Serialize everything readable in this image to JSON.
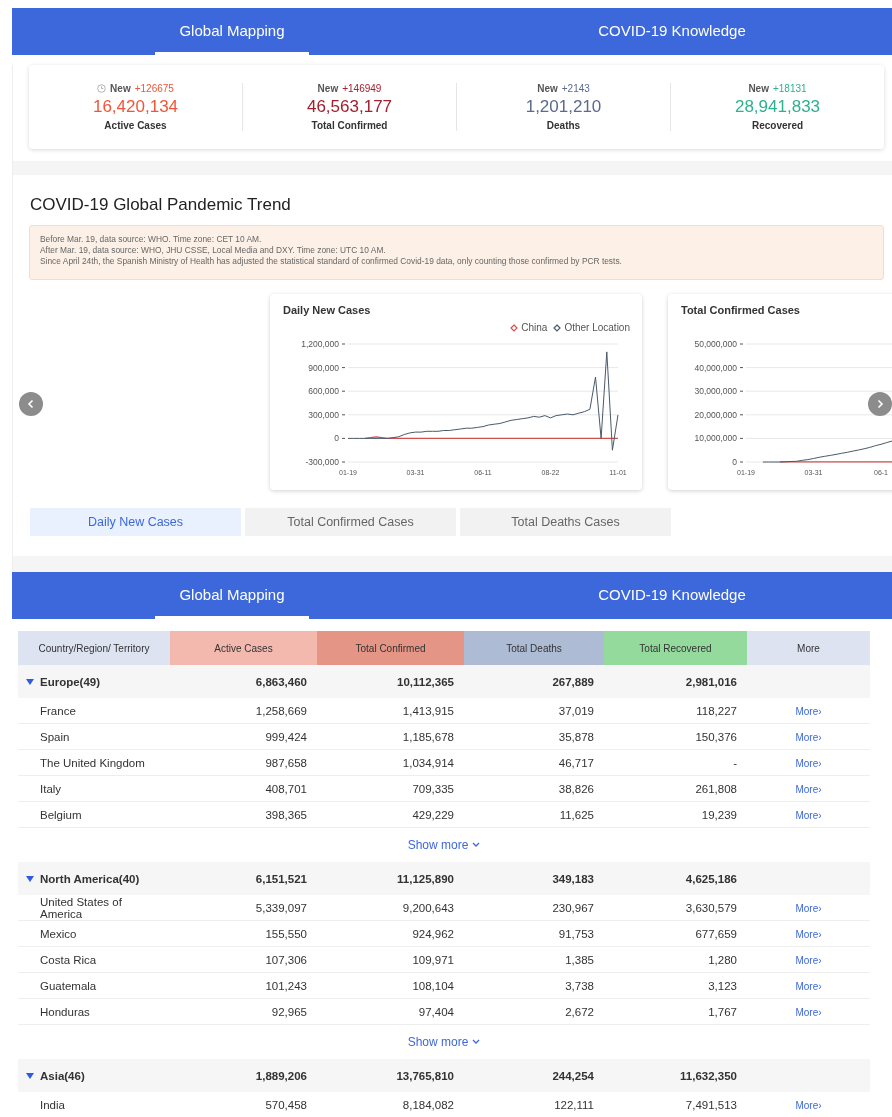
{
  "top_tabs": [
    {
      "label": "Global Mapping",
      "selected": true
    },
    {
      "label": "COVID-19 Knowledge",
      "selected": false
    }
  ],
  "stats": [
    {
      "new_label": "New",
      "new_value": "+126675",
      "value": "16,420,134",
      "label": "Active Cases",
      "color": "#f0553a",
      "clock": true
    },
    {
      "new_label": "New",
      "new_value": "+146949",
      "value": "46,563,177",
      "label": "Total Confirmed",
      "color": "#a3202f",
      "clock": false
    },
    {
      "new_label": "New",
      "new_value": "+2143",
      "value": "1,201,210",
      "label": "Deaths",
      "color": "#5b6a8e",
      "clock": false
    },
    {
      "new_label": "New",
      "new_value": "+18131",
      "value": "28,941,833",
      "label": "Recovered",
      "color": "#2fb08e",
      "clock": false
    }
  ],
  "trend": {
    "title": "COVID-19 Global Pandemic Trend",
    "notes": [
      "Before Mar. 19, data source: WHO. Time zone: CET 10 AM.",
      "After Mar. 19, data source: WHO, JHU CSSE, Local Media and DXY. Time zone: UTC 10 AM.",
      "Since April 24th, the Spanish Ministry of Health has adjusted the statistical standard of confirmed Covid-19 data, only counting those confirmed by PCR tests."
    ],
    "charts": [
      {
        "chart_data": {
          "type": "line",
          "title": "Daily New Cases",
          "categories": [
            "01-19",
            null,
            null,
            null,
            null,
            null,
            null,
            null,
            null,
            null,
            null,
            null,
            "03-31",
            null,
            null,
            null,
            null,
            null,
            null,
            null,
            null,
            null,
            null,
            null,
            "06-11",
            null,
            null,
            null,
            null,
            null,
            null,
            null,
            null,
            null,
            null,
            null,
            "08-22",
            null,
            null,
            null,
            null,
            null,
            null,
            null,
            null,
            null,
            null,
            null,
            "11-01"
          ],
          "series": [
            {
              "name": "China",
              "color": "#d05050",
              "values": [
                null,
                null,
                null,
                0,
                10000,
                20000,
                10000,
                0,
                0,
                0,
                0,
                0,
                0,
                0,
                0,
                0,
                0,
                0,
                0,
                0,
                0,
                0,
                0,
                0,
                0,
                0,
                0,
                0,
                0,
                0,
                0,
                0,
                0,
                0,
                0,
                0,
                0,
                0,
                0,
                0,
                0,
                0,
                0,
                0,
                0,
                0,
                0,
                0,
                0
              ]
            },
            {
              "name": "Other Location",
              "color": "#4a5a6a",
              "values": [
                0,
                0,
                0,
                0,
                0,
                0,
                0,
                0,
                10000,
                20000,
                50000,
                70000,
                80000,
                80000,
                90000,
                90000,
                90000,
                100000,
                100000,
                110000,
                120000,
                130000,
                130000,
                140000,
                150000,
                170000,
                180000,
                190000,
                210000,
                230000,
                240000,
                250000,
                260000,
                280000,
                270000,
                290000,
                260000,
                290000,
                300000,
                310000,
                300000,
                320000,
                340000,
                370000,
                780000,
                0,
                1100000,
                -150000,
                300000
              ]
            }
          ],
          "ylim": [
            -300000,
            1200000
          ],
          "grid": true,
          "legend": true,
          "yticks": [
            {
              "value": 1200000,
              "label": "1,200,000"
            },
            {
              "value": 900000,
              "label": "900,000"
            },
            {
              "value": 600000,
              "label": "600,000"
            },
            {
              "value": 300000,
              "label": "300,000"
            },
            {
              "value": 0,
              "label": "0"
            },
            {
              "value": -300000,
              "label": "-300,000"
            }
          ]
        }
      },
      {
        "chart_data": {
          "type": "line",
          "title": "Total Confirmed Cases",
          "categories": [
            "01-19",
            null,
            null,
            null,
            null,
            null,
            null,
            null,
            null,
            null,
            null,
            null,
            "03-31",
            null,
            null,
            null,
            null,
            null,
            null,
            null,
            null,
            null,
            null,
            null,
            "06-1",
            null,
            null,
            null,
            null,
            null,
            null,
            null,
            null,
            null,
            null,
            null,
            null,
            null,
            null,
            null,
            null,
            null,
            null,
            null,
            null,
            null,
            null,
            null,
            null
          ],
          "series": [
            {
              "color": "#d05050",
              "values": [
                null,
                null,
                null,
                null,
                null,
                null,
                100000,
                100000,
                100000,
                100000,
                100000,
                100000,
                100000,
                100000,
                100000,
                100000,
                100000,
                100000,
                100000,
                100000,
                100000,
                100000,
                100000,
                100000,
                100000,
                100000,
                100000,
                null,
                null,
                null,
                null,
                null,
                null,
                null,
                null,
                null,
                null,
                null,
                null,
                null,
                null,
                null,
                null,
                null,
                null,
                null,
                null,
                null,
                null
              ]
            },
            {
              "color": "#4a5a6a",
              "values": [
                null,
                null,
                null,
                0,
                0,
                0,
                0,
                100000,
                200000,
                300000,
                700000,
                1000000,
                1500000,
                2000000,
                2400000,
                2800000,
                3200000,
                3700000,
                4100000,
                4600000,
                5100000,
                5600000,
                6200000,
                6900000,
                7500000,
                8200000,
                8900000,
                null,
                null,
                null,
                null,
                null,
                null,
                null,
                null,
                null,
                null,
                null,
                null,
                null,
                null,
                null,
                null,
                null,
                null,
                null,
                null,
                null,
                null
              ]
            }
          ],
          "ylim": [
            0,
            50000000
          ],
          "grid": true,
          "yticks": [
            {
              "value": 50000000,
              "label": "50,000,000"
            },
            {
              "value": 40000000,
              "label": "40,000,000"
            },
            {
              "value": 30000000,
              "label": "30,000,000"
            },
            {
              "value": 20000000,
              "label": "20,000,000"
            },
            {
              "value": 10000000,
              "label": "10,000,000"
            },
            {
              "value": 0,
              "label": "0"
            }
          ]
        }
      }
    ],
    "chart_tabs": [
      {
        "label": "Daily New Cases",
        "selected": true
      },
      {
        "label": "Total Confirmed Cases",
        "selected": false
      },
      {
        "label": "Total Deaths Cases",
        "selected": false
      }
    ]
  },
  "bottom_tabs": [
    {
      "label": "Global Mapping",
      "selected": true
    },
    {
      "label": "COVID-19 Knowledge",
      "selected": false
    }
  ],
  "table": {
    "columns": [
      {
        "label": "Country/Region/ Territory",
        "color": "#dde3f1"
      },
      {
        "label": "Active Cases",
        "color": "#f3b9af"
      },
      {
        "label": "Total Confirmed",
        "color": "#e59585"
      },
      {
        "label": "Total Deaths",
        "color": "#aebbd4"
      },
      {
        "label": "Total Recovered",
        "color": "#94da9c"
      },
      {
        "label": "More",
        "color": "#dde3f1"
      }
    ],
    "groups": [
      {
        "name": "Europe(49)",
        "expanded": true,
        "totals": [
          "6,863,460",
          "10,112,365",
          "267,889",
          "2,981,016"
        ],
        "show_more": "Show more",
        "rows": [
          {
            "name": "France",
            "values": [
              "1,258,669",
              "1,413,915",
              "37,019",
              "118,227"
            ],
            "link": "More›"
          },
          {
            "name": "Spain",
            "values": [
              "999,424",
              "1,185,678",
              "35,878",
              "150,376"
            ],
            "link": "More›"
          },
          {
            "name": "The United Kingdom",
            "values": [
              "987,658",
              "1,034,914",
              "46,717",
              "-"
            ],
            "link": "More›"
          },
          {
            "name": "Italy",
            "values": [
              "408,701",
              "709,335",
              "38,826",
              "261,808"
            ],
            "link": "More›"
          },
          {
            "name": "Belgium",
            "values": [
              "398,365",
              "429,229",
              "11,625",
              "19,239"
            ],
            "link": "More›"
          }
        ]
      },
      {
        "name": "North America(40)",
        "expanded": true,
        "totals": [
          "6,151,521",
          "11,125,890",
          "349,183",
          "4,625,186"
        ],
        "show_more": "Show more",
        "rows": [
          {
            "name": "United States of America",
            "values": [
              "5,339,097",
              "9,200,643",
              "230,967",
              "3,630,579"
            ],
            "link": "More›"
          },
          {
            "name": "Mexico",
            "values": [
              "155,550",
              "924,962",
              "91,753",
              "677,659"
            ],
            "link": "More›"
          },
          {
            "name": "Costa Rica",
            "values": [
              "107,306",
              "109,971",
              "1,385",
              "1,280"
            ],
            "link": "More›"
          },
          {
            "name": "Guatemala",
            "values": [
              "101,243",
              "108,104",
              "3,738",
              "3,123"
            ],
            "link": "More›"
          },
          {
            "name": "Honduras",
            "values": [
              "92,965",
              "97,404",
              "2,672",
              "1,767"
            ],
            "link": "More›"
          }
        ]
      },
      {
        "name": "Asia(46)",
        "expanded": true,
        "totals": [
          "1,889,206",
          "13,765,810",
          "244,254",
          "11,632,350"
        ],
        "rows": [
          {
            "name": "India",
            "values": [
              "570,458",
              "8,184,082",
              "122,111",
              "7,491,513"
            ],
            "link": "More›"
          }
        ]
      }
    ]
  }
}
